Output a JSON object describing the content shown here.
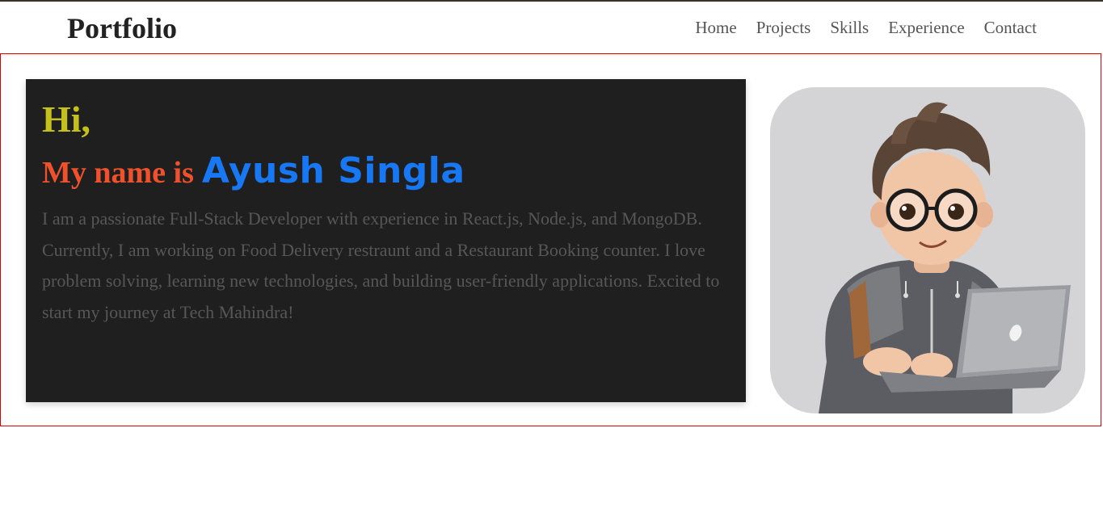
{
  "header": {
    "brand": "Portfolio",
    "nav": [
      "Home",
      "Projects",
      "Skills",
      "Experience",
      "Contact"
    ]
  },
  "hero": {
    "greeting": "Hi,",
    "name_prefix": "My name is",
    "name": "Ayush Singla",
    "bio": "I am a passionate Full-Stack Developer with experience in React.js, Node.js, and MongoDB. Currently, I am working on Food Delivery restraunt and a Restaurant Booking counter. I love problem solving, learning new technologies, and building user-friendly applications. Excited to start my journey at Tech Mahindra!",
    "avatar_icon": "developer-avatar-illustration"
  },
  "colors": {
    "greeting": "#c5c11c",
    "name_prefix": "#f0512d",
    "name": "#1877f2",
    "card_bg": "#1f1f1f",
    "hero_border": "#e00000"
  }
}
